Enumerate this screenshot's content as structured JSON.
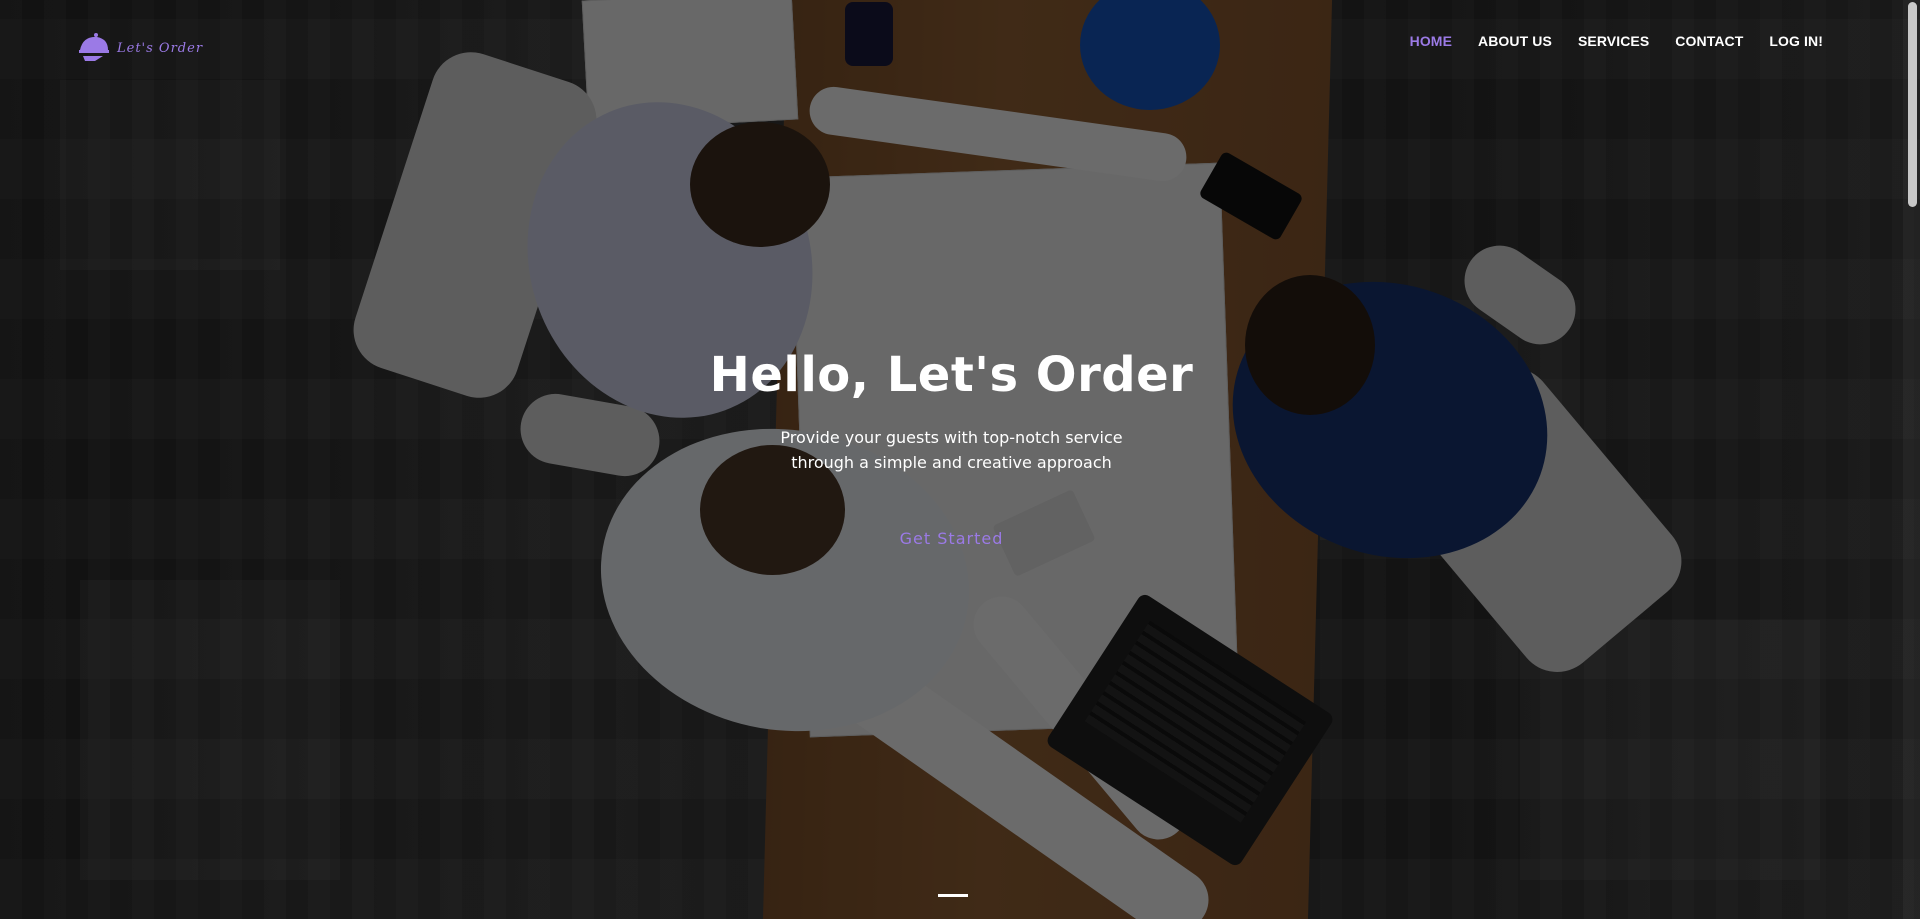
{
  "brand": {
    "name": "Let's Order",
    "accent_color": "#9b7ae6",
    "icon": "cloche-serving-icon"
  },
  "nav": {
    "items": [
      {
        "label": "HOME",
        "active": true
      },
      {
        "label": "ABOUT US",
        "active": false
      },
      {
        "label": "SERVICES",
        "active": false
      },
      {
        "label": "CONTACT",
        "active": false
      },
      {
        "label": "LOG IN!",
        "active": false
      }
    ]
  },
  "hero": {
    "title": "Hello, Let's Order",
    "subtitle_line1": "Provide your guests with top-notch service",
    "subtitle_line2": "through a simple and creative approach",
    "cta_label": "Get Started"
  }
}
